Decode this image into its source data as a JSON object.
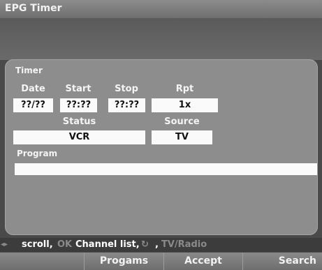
{
  "window": {
    "title": "EPG Timer"
  },
  "timer": {
    "section_label": "Timer",
    "date_label": "Date",
    "date_value": "??/??",
    "start_label": "Start",
    "start_value": "??:??",
    "stop_label": "Stop",
    "stop_value": "??:??",
    "rpt_label": "Rpt",
    "rpt_value": "1x",
    "status_label": "Status",
    "status_value": "VCR",
    "source_label": "Source",
    "source_value": "TV",
    "program_label": "Program",
    "program_value": ""
  },
  "help": {
    "scroll_icon": "◂▸",
    "scroll_text": "scroll,",
    "ok_key": "OK",
    "channel_list": "Channel list,",
    "tvradio_icon": "↻",
    "sep": ",",
    "tvradio_text": "TV/Radio"
  },
  "softkeys": {
    "programs": "Progams",
    "accept": "Accept",
    "search": "Search"
  }
}
